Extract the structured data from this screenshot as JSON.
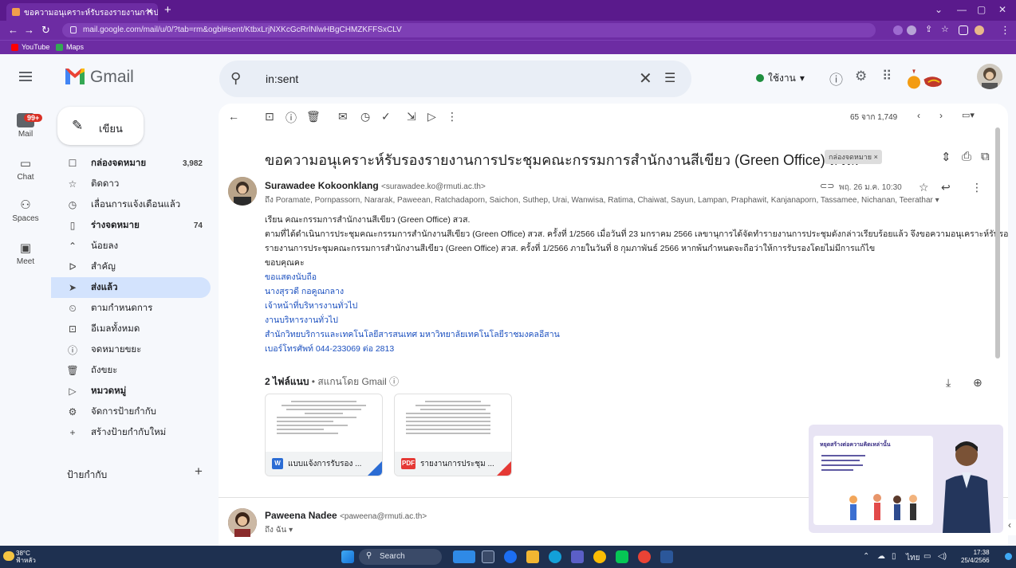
{
  "browser": {
    "tab_title": "ขอความอนุเคราะห์รับรองรายงานการประ",
    "url": "mail.google.com/mail/u/0/?tab=rm&ogbl#sent/KtbxLrjNXKcGcRrlNlwHBgCHMZKFFSxCLV",
    "bookmarks": [
      {
        "label": "YouTube",
        "color": "#ff0000"
      },
      {
        "label": "Maps",
        "color": "#34a853"
      }
    ]
  },
  "gmail": {
    "logo_text": "Gmail",
    "search_query": "in:sent",
    "status_label": "ใช้งาน",
    "rail": [
      {
        "label": "Mail",
        "icon": "mail-icon"
      },
      {
        "label": "Chat",
        "icon": "chat-icon"
      },
      {
        "label": "Spaces",
        "icon": "spaces-icon"
      },
      {
        "label": "Meet",
        "icon": "meet-icon"
      }
    ],
    "mail_badge": "99+",
    "compose_label": "เขียน",
    "nav": [
      {
        "label": "กล่องจดหมาย",
        "count": "3,982",
        "icon": "☐"
      },
      {
        "label": "ติดดาว",
        "count": "",
        "icon": "☆"
      },
      {
        "label": "เลื่อนการแจ้งเตือนแล้ว",
        "count": "",
        "icon": "◷"
      },
      {
        "label": "ร่างจดหมาย",
        "count": "74",
        "icon": "▯"
      },
      {
        "label": "น้อยลง",
        "count": "",
        "icon": "⌃"
      },
      {
        "label": "สำคัญ",
        "count": "",
        "icon": "ᐅ"
      },
      {
        "label": "ส่งแล้ว",
        "count": "",
        "icon": "➤"
      },
      {
        "label": "ตามกำหนดการ",
        "count": "",
        "icon": "⏲"
      },
      {
        "label": "อีเมลทั้งหมด",
        "count": "",
        "icon": "⊡"
      },
      {
        "label": "จดหมายขยะ",
        "count": "",
        "icon": "ⓘ"
      },
      {
        "label": "ถังขยะ",
        "count": "",
        "icon": "🗑"
      },
      {
        "label": "หมวดหมู่",
        "count": "",
        "icon": "▷"
      },
      {
        "label": "จัดการป้ายกำกับ",
        "count": "",
        "icon": "⚙"
      },
      {
        "label": "สร้างป้ายกำกับใหม่",
        "count": "",
        "icon": "+"
      }
    ],
    "labels_title": "ป้ายกำกับ"
  },
  "email": {
    "pager": "65 จาก 1,749",
    "subject": "ขอความอนุเคราะห์รับรองรายงานการประชุมคณะกรรมการสำนักงานสีเขียว (Green Office) สวส.",
    "label_chip": "กล่องจดหมาย ×",
    "sender_name": "Surawadee Kokoonklang",
    "sender_email": "<surawadee.ko@rmuti.ac.th>",
    "recipients": "ถึง Poramate, Pornpassorn, Nararak, Paweean, Ratchadaporn, Saichon, Suthep, Urai, Wanwisa, Ratima, Chaiwat, Sayun, Lampan, Praphawit, Kanjanaporn, Tassamee, Nichanan, Teerathar ▾",
    "date": "พฤ. 26 ม.ค. 10:30",
    "body_lines": [
      "เรียน คณะกรรมการสำนักงานสีเขียว (Green Office) สวส.",
      "ตามที่ได้ดำเนินการประชุมคณะกรรมการสำนักงานสีเขียว (Green Office) สวส. ครั้งที่ 1/2566 เมื่อวันที่ 23 มกราคม 2566 เลขานุการได้จัดทำรายงานการประชุมดังกล่าวเรียบร้อยแล้ว จึงขอความอนุเคราะห์รับรอง",
      "รายงานการประชุมคณะกรรมการสำนักงานสีเขียว (Green Office) สวส. ครั้งที่ 1/2566 ภายในวันที่ 8 กุมภาพันธ์ 2566  หากพ้นกำหนดจะถือว่าให้การรับรองโดยไม่มีการแก้ไข",
      "ขอบคุณคะ"
    ],
    "signature_lines": [
      "ขอแสดงนับถือ",
      "นางสุรวดี  กอคูณกลาง",
      "เจ้าหน้าที่บริหารงานทั่วไป",
      "งานบริหารงานทั่วไป",
      "สำนักวิทยบริการและเทคโนโลยีสารสนเทศ มหาวิทยาลัยเทคโนโลยีราชมงคลอีสาน",
      "เบอร์โทรศัพท์ 044-233069 ต่อ 2813"
    ],
    "attachments_title": "2 ไฟล์แนบ",
    "attachments_scan": " • สแกนโดย Gmail ⓘ",
    "attachments": [
      {
        "name": "แบบแจ้งการรับรอง ...",
        "type": "W",
        "color": "#2b6cd4"
      },
      {
        "name": "รายงานการประชุม ...",
        "type": "PDF",
        "color": "#e53935"
      }
    ],
    "reply_sender": "Paweena Nadee",
    "reply_email": "<paweena@rmuti.ac.th>",
    "reply_to": "ถึง ฉัน ▾"
  },
  "video": {
    "title": "หยุดสร้างต่อความคิดเหล่านั้น"
  },
  "taskbar": {
    "weather_temp": "38°C",
    "weather_desc": "ฟ้าหลัว",
    "search_label": "Search",
    "lang": "ไทย",
    "time": "17:38",
    "date": "25/4/2566"
  }
}
